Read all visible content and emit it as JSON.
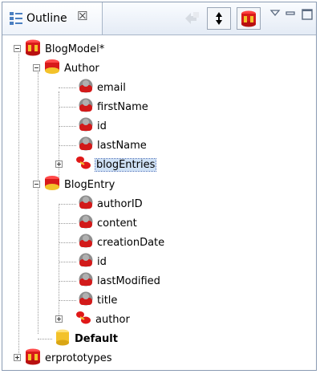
{
  "view": {
    "tab_label": "Outline",
    "tab_close": "☒"
  },
  "toolbar": {
    "icons": [
      "link-icon",
      "sort-icon",
      "model-icon",
      "view-menu-icon",
      "minimize-icon",
      "maximize-icon"
    ]
  },
  "tree": {
    "model": "BlogModel*",
    "entity_author": "Author",
    "author_attrs": [
      "email",
      "firstName",
      "id",
      "lastName"
    ],
    "author_rel": "blogEntries",
    "entity_blogentry": "BlogEntry",
    "blogentry_attrs": [
      "authorID",
      "content",
      "creationDate",
      "id",
      "lastModified",
      "title"
    ],
    "blogentry_rel": "author",
    "default_db": "Default",
    "other_model": "erprototypes"
  },
  "colors": {
    "selection": "#cfe1f5",
    "entity_red": "#e01818",
    "db_yellow": "#f3c22a"
  }
}
